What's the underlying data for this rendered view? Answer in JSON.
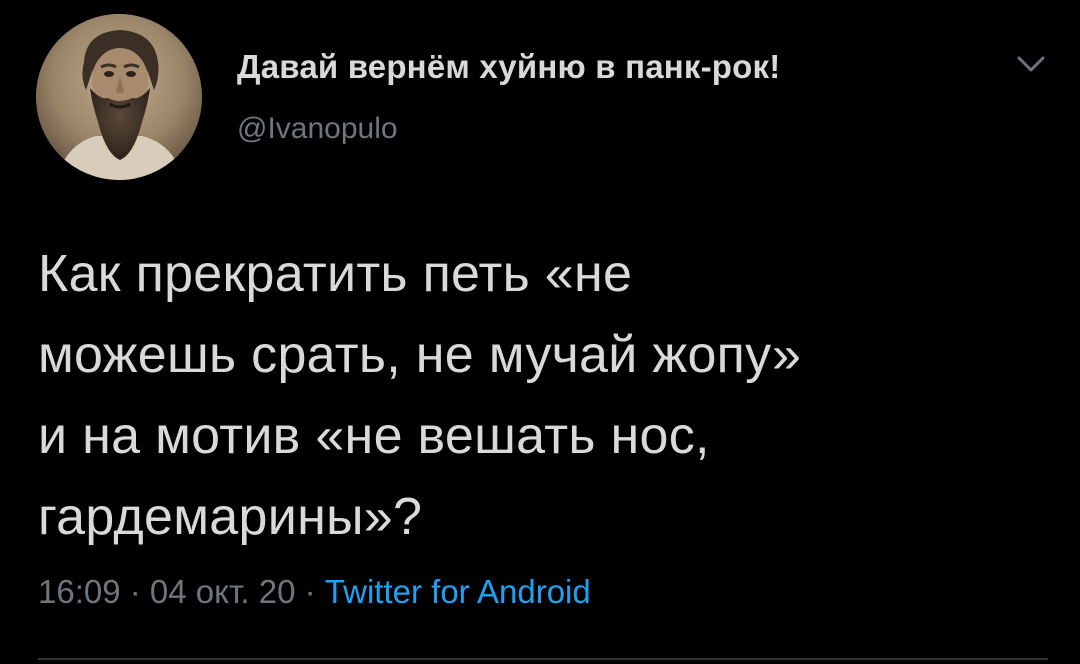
{
  "author": {
    "display_name": "Давай вернём хуйню в панк-рок!",
    "handle": "@Ivanopulo",
    "avatar_icon": "bearded-man-photo"
  },
  "menu_icon": "chevron-down-icon",
  "tweet": {
    "text_lines": [
      "Как прекратить петь «не",
      "можешь срать, не мучай жопу»",
      "и на мотив «не вешать нос,",
      "гардемарины»?"
    ]
  },
  "meta": {
    "time": "16:09",
    "separator1": " · ",
    "date": "04 окт. 20",
    "separator2": " · ",
    "source": "Twitter for Android"
  },
  "colors": {
    "background": "#000000",
    "text": "#d9d9d9",
    "secondary": "#6e767d",
    "link": "#1da1f2",
    "divider": "#2f3336"
  }
}
